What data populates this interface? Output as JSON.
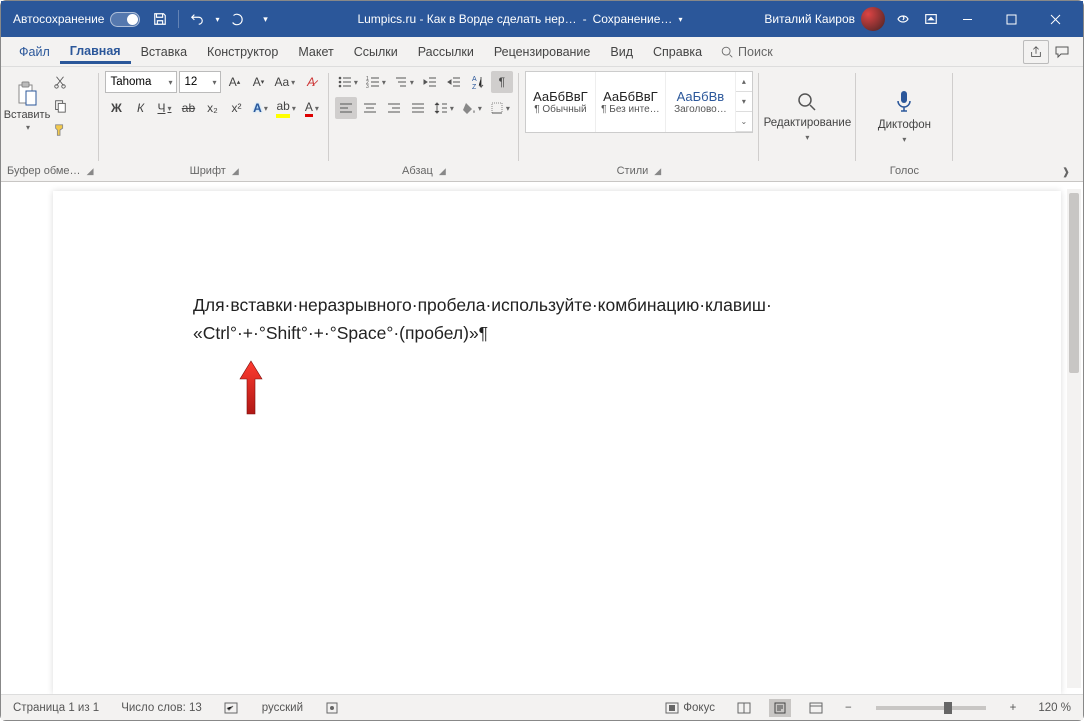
{
  "titlebar": {
    "autosave_label": "Автосохранение",
    "doc_name": "Lumpics.ru - Как в Ворде сделать нер…",
    "save_status": "Сохранение…",
    "user_name": "Виталий Каиров"
  },
  "menubar": {
    "items": [
      "Файл",
      "Главная",
      "Вставка",
      "Конструктор",
      "Макет",
      "Ссылки",
      "Рассылки",
      "Рецензирование",
      "Вид",
      "Справка"
    ],
    "active_index": 1,
    "search_placeholder": "Поиск"
  },
  "ribbon": {
    "clipboard": {
      "label": "Буфер обме…",
      "paste": "Вставить"
    },
    "font": {
      "label": "Шрифт",
      "name": "Tahoma",
      "size": "12",
      "bold": "Ж",
      "italic": "К",
      "underline": "Ч",
      "strike": "ab",
      "sub": "x₂",
      "sup": "x²"
    },
    "paragraph": {
      "label": "Абзац"
    },
    "styles": {
      "label": "Стили",
      "items": [
        {
          "preview": "АаБбВвГ",
          "name": "¶ Обычный"
        },
        {
          "preview": "АаБбВвГ",
          "name": "¶ Без инте…"
        },
        {
          "preview": "АаБбВв",
          "name": "Заголово…"
        }
      ]
    },
    "editing": {
      "label": "Редактирование"
    },
    "voice": {
      "label": "Голос",
      "dictate": "Диктофон"
    }
  },
  "document": {
    "line1": "Для·вставки·неразрывного·пробела·используйте·комбинацию·клавиш·",
    "line2": "«Ctrl°·+·°Shift°·+·°Space°·(пробел)»¶"
  },
  "statusbar": {
    "page": "Страница 1 из 1",
    "words": "Число слов: 13",
    "lang": "русский",
    "focus": "Фокус",
    "zoom": "120 %"
  }
}
